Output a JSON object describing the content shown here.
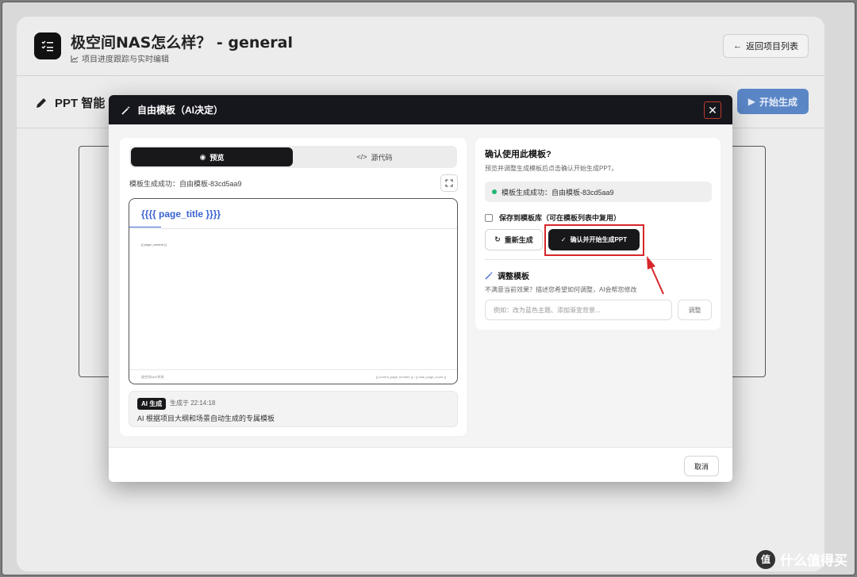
{
  "app": {
    "title": "极空间NAS怎么样？ - general",
    "subtitle": "项目进度跟踪与实时编辑",
    "back_label": "返回项目列表",
    "section_title": "PPT 智能",
    "start_label": "开始生成"
  },
  "modal": {
    "title": "自由模板（AI决定）",
    "tabs": [
      {
        "label": "预览",
        "active": true
      },
      {
        "label": "源代码",
        "active": false
      }
    ],
    "gen_status": "模板生成成功：自由模板-83cd5aa9",
    "preview": {
      "page_title": "{{{{ page_title }}}}",
      "page_content": "{{ page_content }}",
      "footer_left": "极空间NAS评测",
      "footer_right": "{{ current_page_number }} / {{ total_page_count }}"
    },
    "ai_info": {
      "badge": "AI 生成",
      "time": "生成于 22:14:18",
      "desc": "AI 根据项目大纲和场景自动生成的专属模板"
    },
    "confirm": {
      "title": "确认使用此模板?",
      "subtitle": "预览并调整生成模板后点击确认开始生成PPT。",
      "success_text": "模板生成成功：自由模板-83cd5aa9",
      "save_label": "保存到模板库（可在模板列表中复用）",
      "regen_label": "重新生成",
      "confirm_label": "确认并开始生成PPT"
    },
    "adjust": {
      "title": "调整模板",
      "subtitle": "不满意当前效果？描述您希望如何调整，AI会帮您修改",
      "placeholder": "例如：改为蓝色主题、添加渐变背景...",
      "button_label": "调整"
    },
    "cancel_label": "取消"
  },
  "watermark": {
    "text": "什么值得买",
    "logo_char": "值"
  },
  "colors": {
    "accent": "#3a62d0",
    "highlight": "#d7262b",
    "success": "#22b573",
    "dark": "#18181b"
  }
}
